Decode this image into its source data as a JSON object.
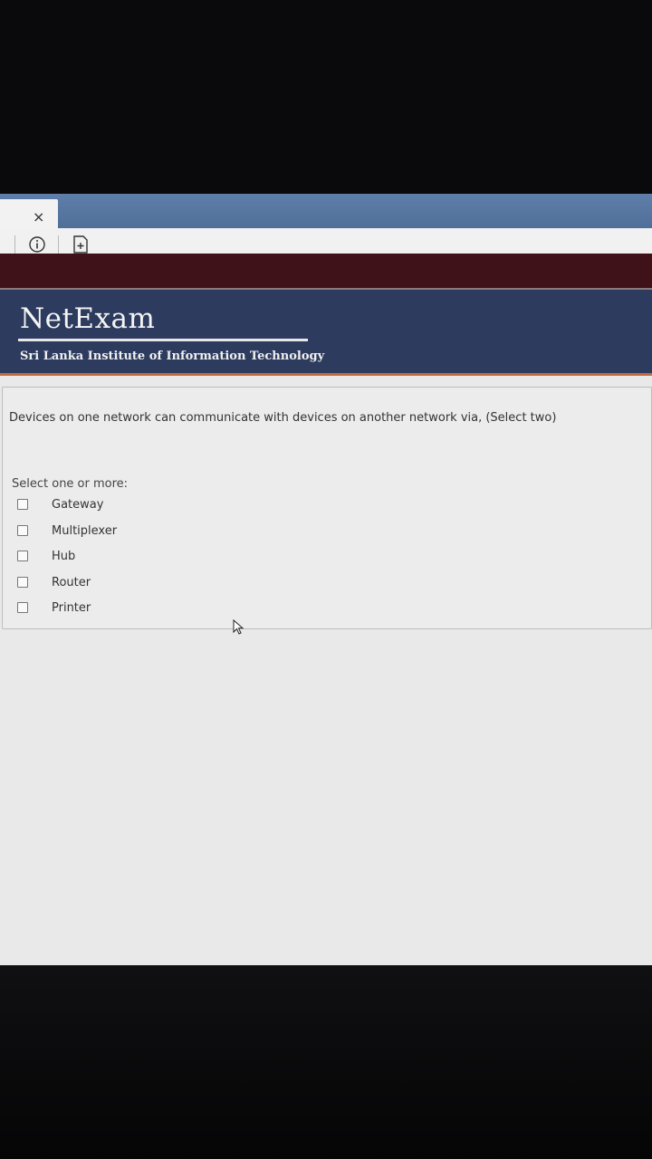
{
  "browser": {
    "tab_close": "×",
    "icons": [
      "close-icon",
      "info-icon",
      "page-icon"
    ]
  },
  "header": {
    "logo": "NetExam",
    "institute": "Sri Lanka Institute of Information Technology"
  },
  "question": {
    "text": "Devices on one network can communicate with devices on another network via, (Select two)",
    "prompt": "Select one or more:",
    "options": [
      {
        "label": "Gateway",
        "checked": false
      },
      {
        "label": "Multiplexer",
        "checked": false
      },
      {
        "label": "Hub",
        "checked": false
      },
      {
        "label": "Router",
        "checked": false
      },
      {
        "label": "Printer",
        "checked": false
      }
    ]
  },
  "colors": {
    "header_bg": "#2d3b5e",
    "maroon_band": "#3e1218",
    "tab_strip": "#5f7faa",
    "accent_rule": "#c46a3a"
  }
}
